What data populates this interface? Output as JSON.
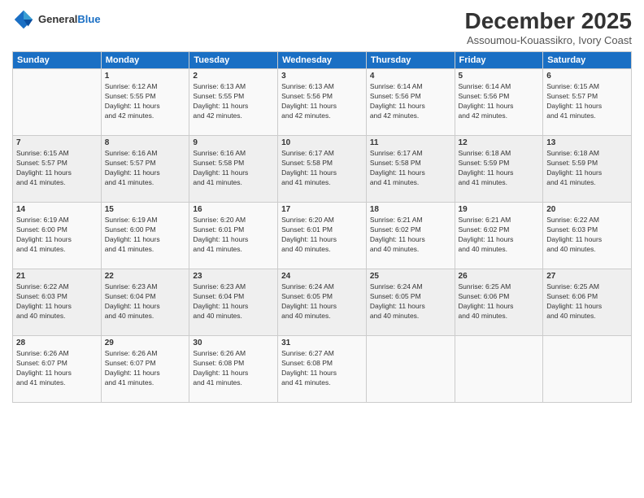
{
  "header": {
    "logo_line1": "General",
    "logo_line2": "Blue",
    "month_title": "December 2025",
    "location": "Assoumou-Kouassikro, Ivory Coast"
  },
  "days_of_week": [
    "Sunday",
    "Monday",
    "Tuesday",
    "Wednesday",
    "Thursday",
    "Friday",
    "Saturday"
  ],
  "weeks": [
    [
      {
        "day": "",
        "info": ""
      },
      {
        "day": "1",
        "info": "Sunrise: 6:12 AM\nSunset: 5:55 PM\nDaylight: 11 hours\nand 42 minutes."
      },
      {
        "day": "2",
        "info": "Sunrise: 6:13 AM\nSunset: 5:55 PM\nDaylight: 11 hours\nand 42 minutes."
      },
      {
        "day": "3",
        "info": "Sunrise: 6:13 AM\nSunset: 5:56 PM\nDaylight: 11 hours\nand 42 minutes."
      },
      {
        "day": "4",
        "info": "Sunrise: 6:14 AM\nSunset: 5:56 PM\nDaylight: 11 hours\nand 42 minutes."
      },
      {
        "day": "5",
        "info": "Sunrise: 6:14 AM\nSunset: 5:56 PM\nDaylight: 11 hours\nand 42 minutes."
      },
      {
        "day": "6",
        "info": "Sunrise: 6:15 AM\nSunset: 5:57 PM\nDaylight: 11 hours\nand 41 minutes."
      }
    ],
    [
      {
        "day": "7",
        "info": "Sunrise: 6:15 AM\nSunset: 5:57 PM\nDaylight: 11 hours\nand 41 minutes."
      },
      {
        "day": "8",
        "info": "Sunrise: 6:16 AM\nSunset: 5:57 PM\nDaylight: 11 hours\nand 41 minutes."
      },
      {
        "day": "9",
        "info": "Sunrise: 6:16 AM\nSunset: 5:58 PM\nDaylight: 11 hours\nand 41 minutes."
      },
      {
        "day": "10",
        "info": "Sunrise: 6:17 AM\nSunset: 5:58 PM\nDaylight: 11 hours\nand 41 minutes."
      },
      {
        "day": "11",
        "info": "Sunrise: 6:17 AM\nSunset: 5:58 PM\nDaylight: 11 hours\nand 41 minutes."
      },
      {
        "day": "12",
        "info": "Sunrise: 6:18 AM\nSunset: 5:59 PM\nDaylight: 11 hours\nand 41 minutes."
      },
      {
        "day": "13",
        "info": "Sunrise: 6:18 AM\nSunset: 5:59 PM\nDaylight: 11 hours\nand 41 minutes."
      }
    ],
    [
      {
        "day": "14",
        "info": "Sunrise: 6:19 AM\nSunset: 6:00 PM\nDaylight: 11 hours\nand 41 minutes."
      },
      {
        "day": "15",
        "info": "Sunrise: 6:19 AM\nSunset: 6:00 PM\nDaylight: 11 hours\nand 41 minutes."
      },
      {
        "day": "16",
        "info": "Sunrise: 6:20 AM\nSunset: 6:01 PM\nDaylight: 11 hours\nand 41 minutes."
      },
      {
        "day": "17",
        "info": "Sunrise: 6:20 AM\nSunset: 6:01 PM\nDaylight: 11 hours\nand 40 minutes."
      },
      {
        "day": "18",
        "info": "Sunrise: 6:21 AM\nSunset: 6:02 PM\nDaylight: 11 hours\nand 40 minutes."
      },
      {
        "day": "19",
        "info": "Sunrise: 6:21 AM\nSunset: 6:02 PM\nDaylight: 11 hours\nand 40 minutes."
      },
      {
        "day": "20",
        "info": "Sunrise: 6:22 AM\nSunset: 6:03 PM\nDaylight: 11 hours\nand 40 minutes."
      }
    ],
    [
      {
        "day": "21",
        "info": "Sunrise: 6:22 AM\nSunset: 6:03 PM\nDaylight: 11 hours\nand 40 minutes."
      },
      {
        "day": "22",
        "info": "Sunrise: 6:23 AM\nSunset: 6:04 PM\nDaylight: 11 hours\nand 40 minutes."
      },
      {
        "day": "23",
        "info": "Sunrise: 6:23 AM\nSunset: 6:04 PM\nDaylight: 11 hours\nand 40 minutes."
      },
      {
        "day": "24",
        "info": "Sunrise: 6:24 AM\nSunset: 6:05 PM\nDaylight: 11 hours\nand 40 minutes."
      },
      {
        "day": "25",
        "info": "Sunrise: 6:24 AM\nSunset: 6:05 PM\nDaylight: 11 hours\nand 40 minutes."
      },
      {
        "day": "26",
        "info": "Sunrise: 6:25 AM\nSunset: 6:06 PM\nDaylight: 11 hours\nand 40 minutes."
      },
      {
        "day": "27",
        "info": "Sunrise: 6:25 AM\nSunset: 6:06 PM\nDaylight: 11 hours\nand 40 minutes."
      }
    ],
    [
      {
        "day": "28",
        "info": "Sunrise: 6:26 AM\nSunset: 6:07 PM\nDaylight: 11 hours\nand 41 minutes."
      },
      {
        "day": "29",
        "info": "Sunrise: 6:26 AM\nSunset: 6:07 PM\nDaylight: 11 hours\nand 41 minutes."
      },
      {
        "day": "30",
        "info": "Sunrise: 6:26 AM\nSunset: 6:08 PM\nDaylight: 11 hours\nand 41 minutes."
      },
      {
        "day": "31",
        "info": "Sunrise: 6:27 AM\nSunset: 6:08 PM\nDaylight: 11 hours\nand 41 minutes."
      },
      {
        "day": "",
        "info": ""
      },
      {
        "day": "",
        "info": ""
      },
      {
        "day": "",
        "info": ""
      }
    ]
  ]
}
